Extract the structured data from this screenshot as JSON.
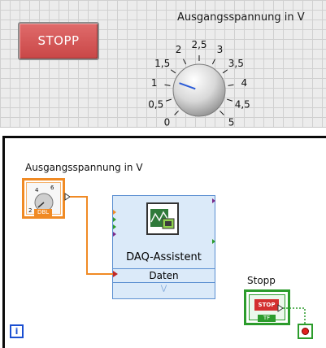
{
  "front_panel": {
    "stop_button_label": "STOPP",
    "knob_label": "Ausgangsspannung in V",
    "knob_ticks": [
      "0",
      "0,5",
      "1",
      "1,5",
      "2",
      "2,5",
      "3",
      "3,5",
      "4",
      "4,5",
      "5"
    ],
    "knob_value": 1.2,
    "knob_range": [
      0,
      5
    ]
  },
  "block_diagram": {
    "knob_terminal_label": "Ausgangsspannung in V",
    "knob_terminal_ticks": [
      "2",
      "4",
      "6"
    ],
    "knob_terminal_badge": "DBL",
    "daq_title": "DAQ-Assistent",
    "daq_data_label": "Daten",
    "stop_terminal_label": "Stopp",
    "stop_terminal_icon_text": "STOP",
    "stop_terminal_badge": "TF",
    "loop_iteration_label": "i"
  },
  "colors": {
    "stop_button_red": "#d04d4d",
    "wire_orange": "#f08a24",
    "wire_green": "#2c9c2c",
    "loop_blue": "#1b4fd1",
    "daq_blue": "#dbeaf9"
  }
}
